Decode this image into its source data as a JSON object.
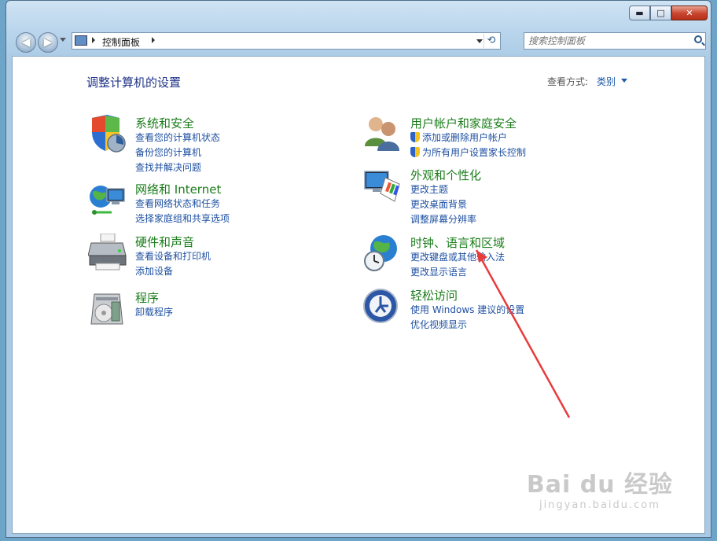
{
  "window": {
    "caption": {
      "minimize": "▬",
      "maximize": "□",
      "close": "✕"
    }
  },
  "nav": {
    "back": "◀",
    "forward": "▶",
    "address": "控制面板",
    "search_placeholder": "搜索控制面板"
  },
  "header": {
    "title": "调整计算机的设置",
    "view_by_label": "查看方式:",
    "view_by_value": "类别"
  },
  "categories": {
    "system": {
      "title": "系统和安全",
      "links": [
        "查看您的计算机状态",
        "备份您的计算机",
        "查找并解决问题"
      ]
    },
    "network": {
      "title": "网络和 Internet",
      "links": [
        "查看网络状态和任务",
        "选择家庭组和共享选项"
      ]
    },
    "hardware": {
      "title": "硬件和声音",
      "links": [
        "查看设备和打印机",
        "添加设备"
      ]
    },
    "programs": {
      "title": "程序",
      "links": [
        "卸载程序"
      ]
    },
    "users": {
      "title": "用户帐户和家庭安全",
      "links": [
        "添加或删除用户帐户",
        "为所有用户设置家长控制"
      ]
    },
    "appearance": {
      "title": "外观和个性化",
      "links": [
        "更改主题",
        "更改桌面背景",
        "调整屏幕分辨率"
      ]
    },
    "clock": {
      "title": "时钟、语言和区域",
      "links": [
        "更改键盘或其他输入法",
        "更改显示语言"
      ]
    },
    "ease": {
      "title": "轻松访问",
      "links": [
        "使用 Windows 建议的设置",
        "优化视频显示"
      ]
    }
  },
  "annotation_color": "#e83b3b",
  "watermark": {
    "main": "Bai du 经验",
    "sub": "jingyan.baidu.com"
  }
}
